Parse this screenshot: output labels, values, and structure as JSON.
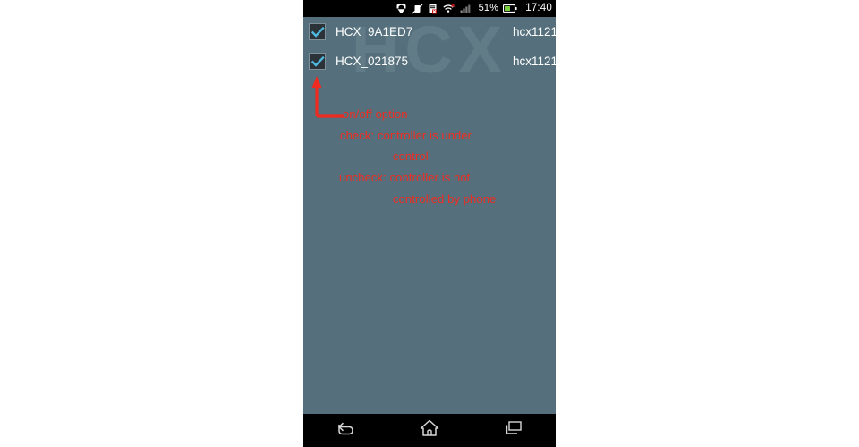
{
  "statusbar": {
    "battery_percent": "51%",
    "clock": "17:40",
    "icons": [
      "headset-icon",
      "vibrate-mute-icon",
      "sync-error-icon",
      "wifi-error-icon",
      "signal-bars-icon",
      "battery-icon"
    ]
  },
  "app": {
    "watermark": "HCX",
    "devices": [
      {
        "checked": true,
        "name": "HCX_9A1ED7",
        "meta": "hcx1121"
      },
      {
        "checked": true,
        "name": "HCX_021875",
        "meta": "hcx1121"
      }
    ]
  },
  "annotation": {
    "color": "#ee2b20",
    "arrow_name": "annotation-arrow-to-checkbox",
    "lines": [
      "on/off option",
      "check: controller is under",
      "control",
      "uncheck: controller is not",
      "controlled by phone"
    ]
  },
  "navbar": {
    "buttons": [
      {
        "name": "back-button",
        "icon": "back-arrow-icon"
      },
      {
        "name": "home-button",
        "icon": "home-icon"
      },
      {
        "name": "recents-button",
        "icon": "recent-apps-icon"
      }
    ]
  },
  "colors": {
    "screen_background": "#55707c",
    "system_bar": "#000000",
    "text": "#ffffff",
    "checkbox_fill": "#2b3238",
    "check_mark": "#4db8e0",
    "annotation_red": "#ee2b20"
  }
}
